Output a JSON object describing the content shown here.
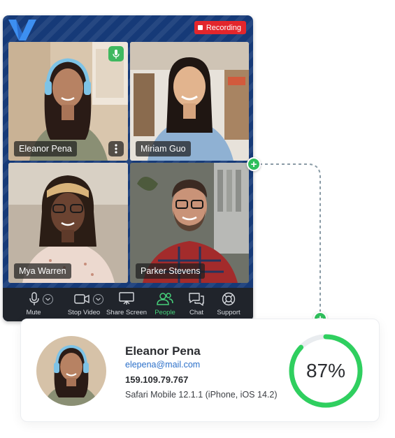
{
  "recording": {
    "label": "Recording"
  },
  "participants": [
    {
      "name": "Eleanor Pena",
      "active": true
    },
    {
      "name": "Miriam Guo"
    },
    {
      "name": "Mya Warren"
    },
    {
      "name": "Parker Stevens"
    }
  ],
  "toolbar": {
    "items": [
      {
        "label": "Mute",
        "icon": "microphone-icon"
      },
      {
        "label": "Stop Video",
        "icon": "video-camera-icon"
      },
      {
        "label": "Share Screen",
        "icon": "share-screen-icon"
      },
      {
        "label": "People",
        "icon": "people-icon",
        "active": true
      },
      {
        "label": "Chat",
        "icon": "chat-icon"
      },
      {
        "label": "Support",
        "icon": "lifebuoy-icon"
      }
    ]
  },
  "profile": {
    "name": "Eleanor Pena",
    "email": "elepena@mail.com",
    "ip": "159.109.79.767",
    "device": "Safari Mobile 12.1.1 (iPhone, iOS 14.2)",
    "score_label": "87%",
    "score": 0.87
  },
  "colors": {
    "accent_green": "#3fcf6e",
    "window_blue": "#163a78",
    "recording_red": "#e3262c",
    "email_blue": "#2a6fc9"
  }
}
